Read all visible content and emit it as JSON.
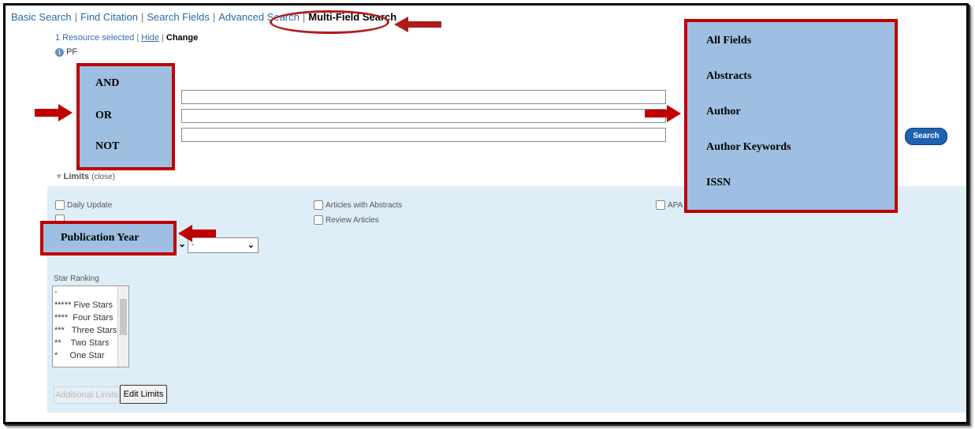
{
  "tabs": {
    "basic": "Basic Search",
    "citation": "Find Citation",
    "fields": "Search Fields",
    "advanced": "Advanced Search",
    "multi": "Multi-Field Search",
    "separator": "|"
  },
  "resource": {
    "selected": "1 Resource selected",
    "hide": "Hide",
    "change": "Change"
  },
  "info_text": "PF",
  "search_button": "Search",
  "limits": {
    "title": "Limits",
    "close": "(close)",
    "daily_update": "Daily Update",
    "abstracts": "Articles with Abstracts",
    "review": "Review Articles",
    "apa": "APA F",
    "year_select": "-"
  },
  "star_ranking": {
    "label": "Star Ranking",
    "options": [
      "-",
      "***** Five Stars",
      "****  Four Stars",
      "***   Three Stars",
      "**    Two Stars",
      "*     One Star"
    ]
  },
  "buttons": {
    "additional": "Additional Limits",
    "edit": "Edit Limits"
  },
  "callouts": {
    "operators": [
      "AND",
      "OR",
      "NOT"
    ],
    "fields": [
      "All Fields",
      "Abstracts",
      "Author",
      "Author Keywords",
      "ISSN"
    ],
    "pub_year": "Publication Year"
  },
  "colors": {
    "callout_fill": "#9ebfe1",
    "callout_border": "#c00000",
    "limits_bg": "#deeef8",
    "link": "#2a6aa5"
  }
}
